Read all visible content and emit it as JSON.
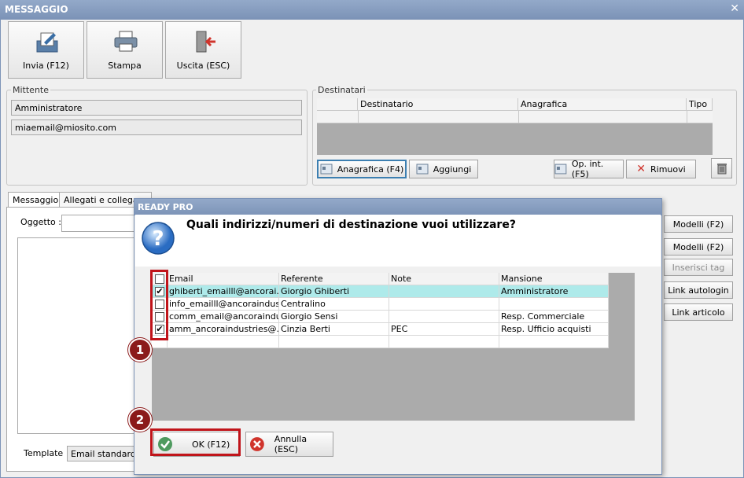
{
  "window": {
    "title": "MESSAGGIO"
  },
  "toolbar": {
    "send_label": "Invia (F12)",
    "print_label": "Stampa",
    "exit_label": "Uscita (ESC)"
  },
  "sender": {
    "group_label": "Mittente",
    "name": "Amministratore",
    "email": "miaemail@miosito.com"
  },
  "recipients": {
    "group_label": "Destinatari",
    "columns": [
      "Destinatario",
      "Anagrafica",
      "Tipo"
    ],
    "buttons": {
      "anagrafica": "Anagrafica (F4)",
      "aggiungi": "Aggiungi",
      "op_int": "Op. int. (F5)",
      "rimuovi": "Rimuovi"
    }
  },
  "tabs": [
    "Messaggio",
    "Allegati e collegame"
  ],
  "message": {
    "subject_label": "Oggetto :",
    "template_label": "Template :",
    "template_value": "Email standard (p"
  },
  "side_buttons": [
    "Modelli (F2)",
    "Modelli (F2)",
    "Inserisci tag",
    "Link autologin",
    "Link articolo"
  ],
  "dialog": {
    "title": "READY PRO",
    "question": "Quali indirizzi/numeri di destinazione vuoi utilizzare?",
    "columns": [
      "Email",
      "Referente",
      "Note",
      "Mansione"
    ],
    "rows": [
      {
        "checked": true,
        "email": "ghiberti_emailll@ancorai...",
        "referente": "Giorgio Ghiberti",
        "note": "",
        "mansione": "Amministratore",
        "highlight": true
      },
      {
        "checked": false,
        "email": "info_emailll@ancoraindus...",
        "referente": "Centralino",
        "note": "",
        "mansione": "",
        "highlight": false
      },
      {
        "checked": false,
        "email": "comm_email@ancoraindu...",
        "referente": "Giorgio Sensi",
        "note": "",
        "mansione": "Resp. Commerciale",
        "highlight": false
      },
      {
        "checked": true,
        "email": "amm_ancoraindustries@...",
        "referente": "Cinzia Berti",
        "note": "PEC",
        "mansione": "Resp. Ufficio acquisti",
        "highlight": false
      }
    ],
    "ok_label": "OK (F12)",
    "cancel_label": "Annulla (ESC)"
  },
  "annotations": {
    "badge1": "1",
    "badge2": "2"
  },
  "colors": {
    "titlebar": "#7c93b7",
    "highlight_row": "#aeeaea",
    "annotation_red": "#c0141a",
    "badge": "#8b1a1a"
  }
}
